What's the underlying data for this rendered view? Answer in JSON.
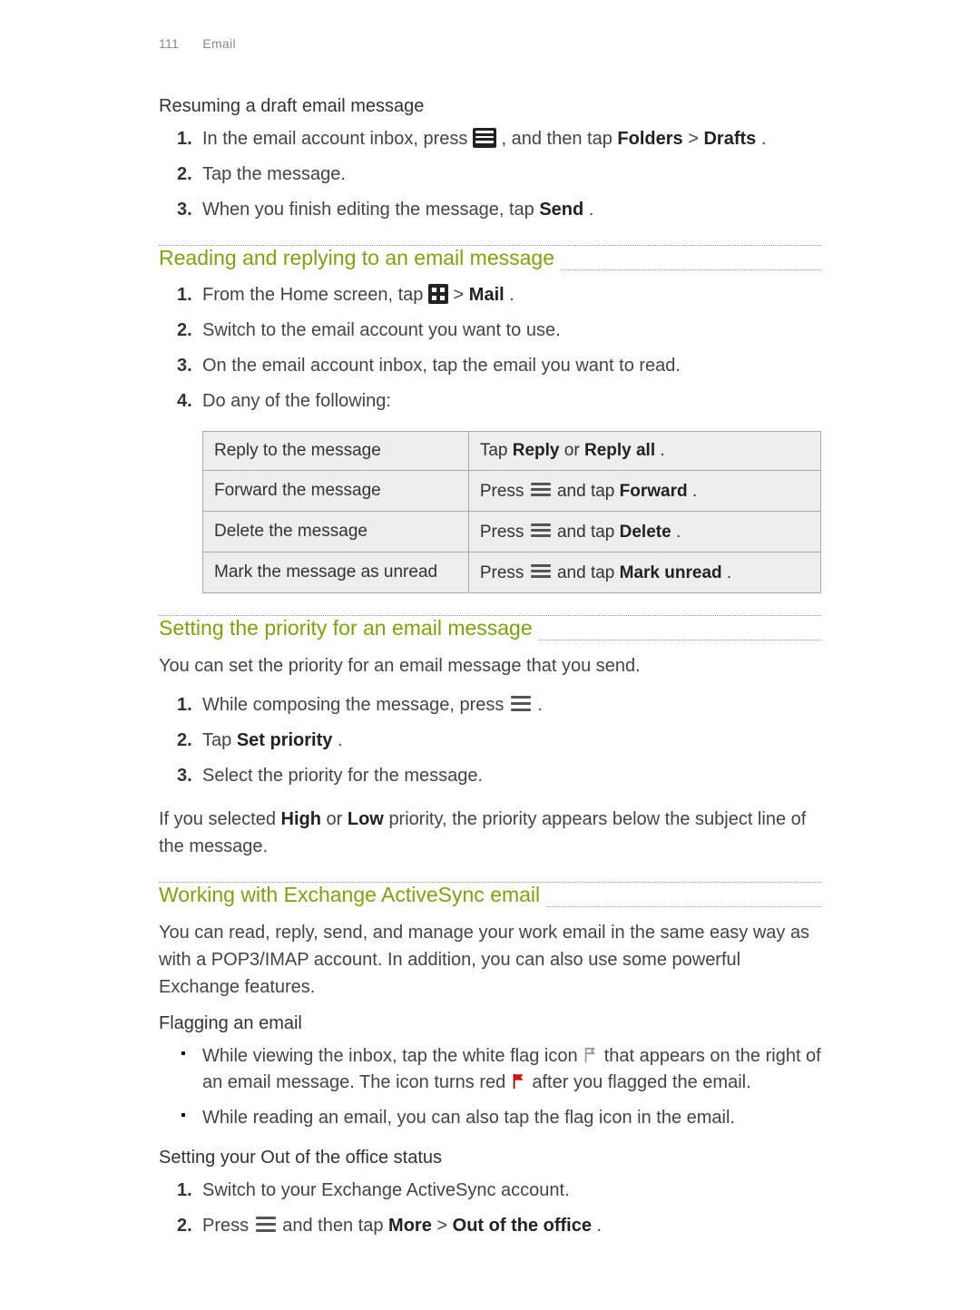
{
  "header": {
    "page_number": "111",
    "chapter": "Email"
  },
  "sec_resume": {
    "title": "Resuming a draft email message",
    "steps": {
      "s1a": "In the email account inbox, press ",
      "s1b": ", and then tap ",
      "s1_folders": "Folders",
      "s1_gt": " > ",
      "s1_drafts": "Drafts",
      "s1_end": ".",
      "s2": "Tap the message.",
      "s3a": "When you finish editing the message, tap ",
      "s3_send": "Send",
      "s3_end": "."
    }
  },
  "sec_read": {
    "title": "Reading and replying to an email message",
    "steps": {
      "s1a": "From the Home screen, tap ",
      "s1_gt": "  > ",
      "s1_mail": "Mail",
      "s1_end": ".",
      "s2": "Switch to the email account you want to use.",
      "s3": "On the email account inbox, tap the email you want to read.",
      "s4": "Do any of the following:"
    },
    "table": {
      "r1c1": "Reply to the message",
      "r1c2a": "Tap ",
      "r1c2_reply": "Reply",
      "r1c2_or": " or ",
      "r1c2_replyall": "Reply all",
      "r1c2_end": ".",
      "r2c1": "Forward the message",
      "r2c2a": "Press ",
      "r2c2b": " and tap ",
      "r2c2_fwd": "Forward",
      "r2c2_end": ".",
      "r3c1": "Delete the message",
      "r3c2a": "Press ",
      "r3c2b": " and tap ",
      "r3c2_del": "Delete",
      "r3c2_end": ".",
      "r4c1": "Mark the message as unread",
      "r4c2a": "Press ",
      "r4c2b": " and tap ",
      "r4c2_mu": "Mark unread",
      "r4c2_end": "."
    }
  },
  "sec_priority": {
    "title": "Setting the priority for an email message",
    "intro": "You can set the priority for an email message that you send.",
    "steps": {
      "s1a": "While composing the message, press ",
      "s1_end": ".",
      "s2a": "Tap ",
      "s2_sp": "Set priority",
      "s2_end": ".",
      "s3": "Select the priority for the message."
    },
    "outro_a": "If you selected ",
    "outro_high": "High",
    "outro_or": " or ",
    "outro_low": "Low",
    "outro_b": " priority, the priority appears below the subject line of the message."
  },
  "sec_eas": {
    "title": "Working with Exchange ActiveSync email",
    "intro": "You can read, reply, send, and manage your work email in the same easy way as with a POP3/IMAP account. In addition, you can also use some powerful Exchange features.",
    "flag_title": "Flagging an email",
    "flag_b1a": "While viewing the inbox, tap the white flag icon ",
    "flag_b1b": " that appears on the right of an email message. The icon turns red ",
    "flag_b1c": " after you flagged the email.",
    "flag_b2": "While reading an email, you can also tap the flag icon in the email.",
    "ooo_title": "Setting your Out of the office status",
    "ooo_s1": "Switch to your Exchange ActiveSync account.",
    "ooo_s2a": "Press ",
    "ooo_s2b": " and then tap ",
    "ooo_more": "More",
    "ooo_gt": " > ",
    "ooo_ooo": "Out of the office",
    "ooo_end": "."
  },
  "nums": {
    "n1": "1.",
    "n2": "2.",
    "n3": "3.",
    "n4": "4."
  }
}
